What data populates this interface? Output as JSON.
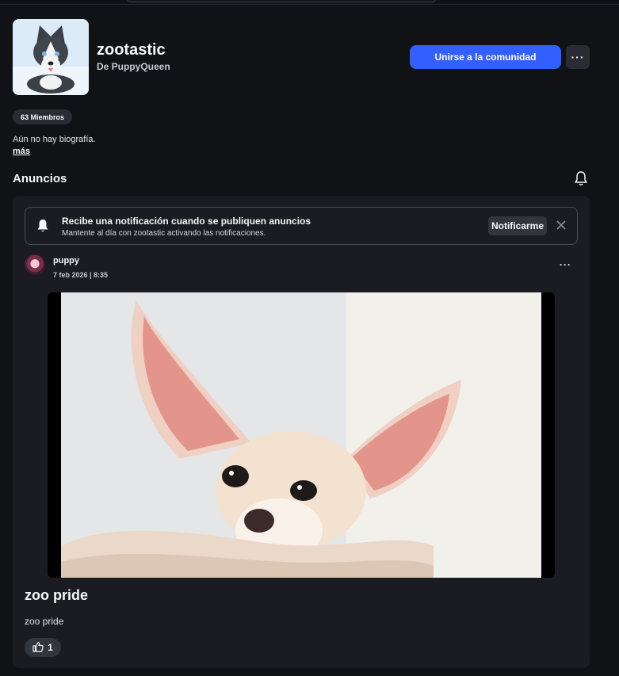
{
  "community": {
    "name": "zootastic",
    "byline": "De PuppyQueen",
    "join_label": "Unirse a la comunidad",
    "more_label": "···",
    "members": "63 Miembros",
    "bio": "Aún no hay biografía.",
    "more_link": "más"
  },
  "announcements": {
    "title": "Anuncios",
    "notify": {
      "title": "Recibe una notificación cuando se publiquen anuncios",
      "subtitle": "Mantente al día con zootastic activando las notificaciones.",
      "button": "Notificarme"
    },
    "post": {
      "user": "puppy",
      "date": "7 feb 2026 | 8:35",
      "more_label": "···",
      "title": "zoo pride",
      "body": "zoo pride",
      "likes": "1"
    }
  },
  "colors": {
    "background": "#111216",
    "card": "#1b1c21",
    "accent": "#335fff",
    "chip": "#2a2c33"
  },
  "icons": [
    "bell-icon",
    "close-icon",
    "thumbs-up-icon",
    "more-icon"
  ]
}
